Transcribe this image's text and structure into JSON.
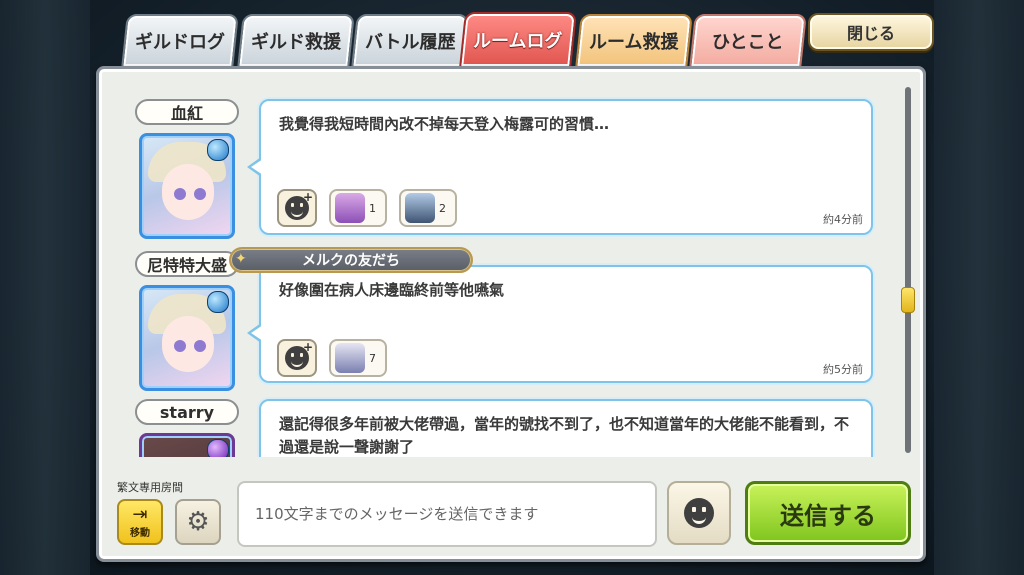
{
  "tabs": [
    {
      "label": "ギルドログ"
    },
    {
      "label": "ギルド救援"
    },
    {
      "label": "バトル履歴"
    },
    {
      "label": "ルームログ"
    },
    {
      "label": "ルーム救援"
    },
    {
      "label": "ひとこと"
    }
  ],
  "active_tab": "ルームログ",
  "close_label": "閉じる",
  "messages": [
    {
      "name": "血紅",
      "text": "我覺得我短時間內改不掉每天登入梅露可的習慣…",
      "reactions": [
        {
          "count": "1"
        },
        {
          "count": "2"
        }
      ],
      "time": "約4分前"
    },
    {
      "name": "尼特特大盛",
      "title": "メルクの友だち",
      "text": "好像圍在病人床邊臨終前等他嚥氣",
      "reactions": [
        {
          "count": "7"
        }
      ],
      "time": "約5分前"
    },
    {
      "name": "starry",
      "text": "還記得很多年前被大佬帶過，當年的號找不到了，也不知道當年的大佬能不能看到，不過還是說一聲謝謝了"
    }
  ],
  "room_name": "繁文専用房間",
  "move_label": "移動",
  "input_placeholder": "110文字までのメッセージを送信できます",
  "send_label": "送信する",
  "colors": {
    "active_tab": "#e0554f",
    "send": "#7fc51e",
    "bubble_border": "#7fc4e8"
  }
}
